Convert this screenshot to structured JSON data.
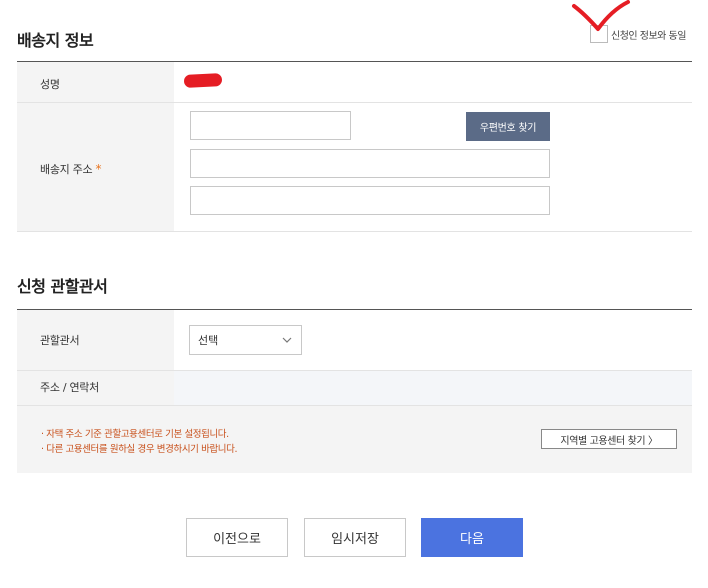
{
  "shipping": {
    "title": "배송지 정보",
    "same_as_applicant": "신청인 정보와 동일",
    "name_label": "성명",
    "address_label": "배송지 주소",
    "required_mark": "*",
    "zipcode_value": "",
    "address1_value": "",
    "address2_value": "",
    "zip_button": "우편번호 찾기"
  },
  "office": {
    "title": "신청 관할관서",
    "office_label": "관할관서",
    "select_value": "선택",
    "contact_label": "주소 / 연락처",
    "contact_value": "",
    "notices": [
      "· 자택 주소 기준 관할고용센터로 기본 설정됩니다.",
      "· 다른 고용센터를 원하실 경우 변경하시기 바랍니다."
    ],
    "find_center_button": "지역별 고용센터 찾기 〉"
  },
  "footer": {
    "prev": "이전으로",
    "save": "임시저장",
    "next": "다음"
  },
  "colors": {
    "primary_button": "#4b73e0",
    "zip_button": "#5b6b87",
    "notice_text": "#c8501b",
    "required": "#e8731e",
    "redaction": "#e51d24"
  }
}
